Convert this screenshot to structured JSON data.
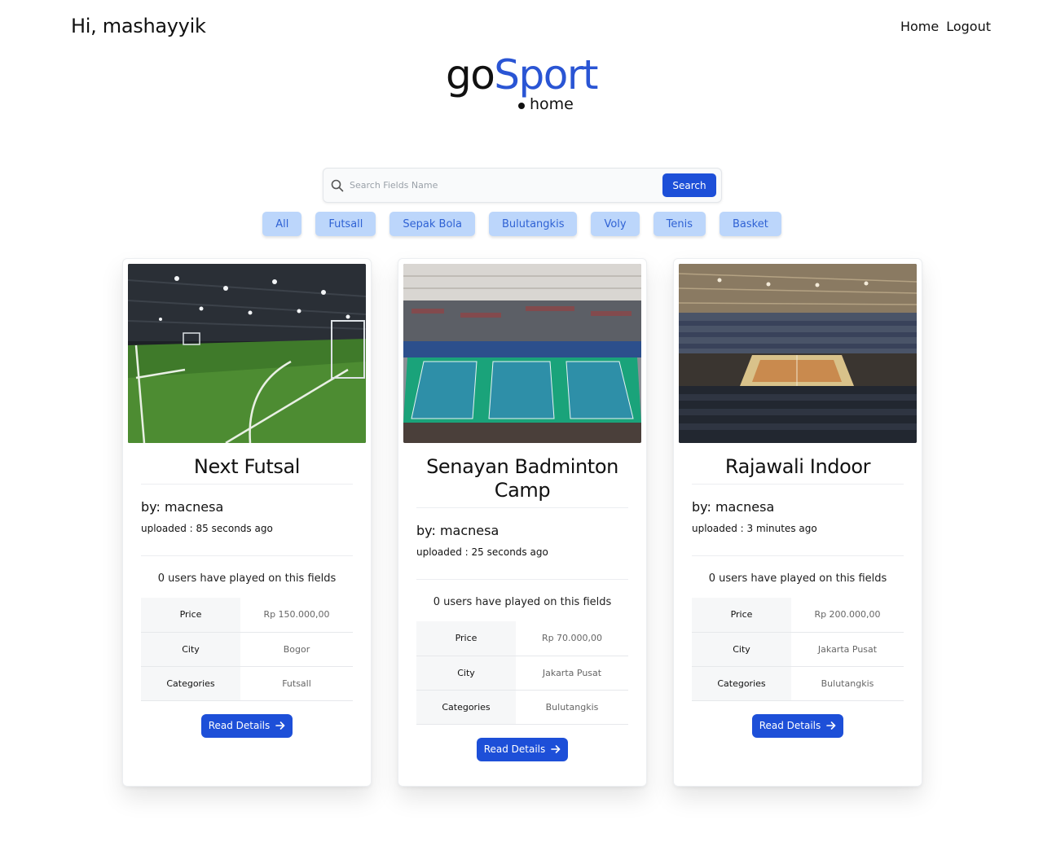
{
  "header": {
    "greeting": "Hi, mashayyik",
    "nav": {
      "home": "Home",
      "logout": "Logout"
    }
  },
  "logo": {
    "part1": "go",
    "part2": "Sport",
    "sub": "home"
  },
  "search": {
    "placeholder": "Search Fields Name",
    "button_label": "Search"
  },
  "categories": [
    "All",
    "Futsall",
    "Sepak Bola",
    "Bulutangkis",
    "Voly",
    "Tenis",
    "Basket"
  ],
  "cards": [
    {
      "title": "Next Futsal",
      "by": "by: macnesa",
      "uploaded": "uploaded : 85 seconds ago",
      "played": "0 users have played on this fields",
      "rows": [
        {
          "label": "Price",
          "value": "Rp 150.000,00"
        },
        {
          "label": "City",
          "value": "Bogor"
        },
        {
          "label": "Categories",
          "value": "Futsall"
        }
      ],
      "button_label": "Read Details"
    },
    {
      "title": "Senayan Badminton Camp",
      "by": "by: macnesa",
      "uploaded": "uploaded : 25 seconds ago",
      "played": "0 users have played on this fields",
      "rows": [
        {
          "label": "Price",
          "value": "Rp 70.000,00"
        },
        {
          "label": "City",
          "value": "Jakarta Pusat"
        },
        {
          "label": "Categories",
          "value": "Bulutangkis"
        }
      ],
      "button_label": "Read Details"
    },
    {
      "title": "Rajawali Indoor",
      "by": "by: macnesa",
      "uploaded": "uploaded : 3 minutes ago",
      "played": "0 users have played on this fields",
      "rows": [
        {
          "label": "Price",
          "value": "Rp 200.000,00"
        },
        {
          "label": "City",
          "value": "Jakarta Pusat"
        },
        {
          "label": "Categories",
          "value": "Bulutangkis"
        }
      ],
      "button_label": "Read Details"
    }
  ],
  "colors": {
    "accent": "#1d4fd8",
    "brand": "#2a55d4",
    "chip_bg": "#bcd6fb",
    "chip_text": "#2f62d4"
  }
}
